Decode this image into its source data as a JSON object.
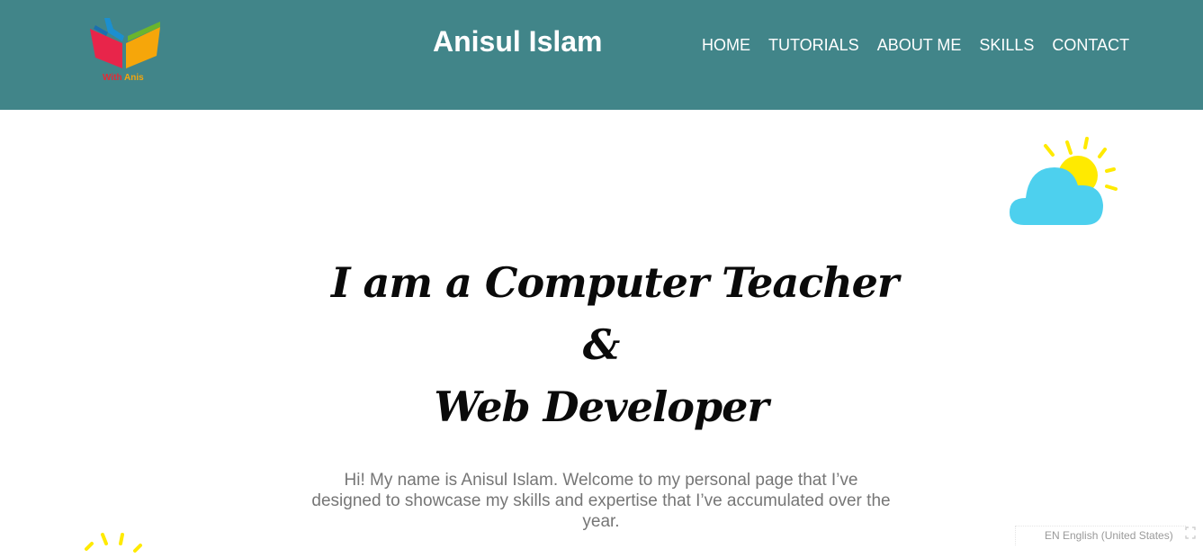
{
  "brand": {
    "logo_text_part1": "With ",
    "logo_text_part2": "Anis",
    "site_title": "Anisul Islam"
  },
  "nav": {
    "items": [
      "HOME",
      "TUTORIALS",
      "ABOUT ME",
      "SKILLS",
      "CONTACT"
    ]
  },
  "hero": {
    "line1": "I am a Computer Teacher",
    "line2": "&",
    "line3": "Web Developer"
  },
  "intro": {
    "text": "Hi! My name is Anisul Islam. Welcome to my personal page that I’ve designed to showcase my skills and expertise that I’ve accumulated over the year."
  },
  "language_bar": {
    "label": "EN English (United States)"
  },
  "colors": {
    "header_bg": "#418589",
    "nav_text": "#ffffff",
    "hero_text": "#0a0a0a",
    "intro_text": "#767676",
    "sun": "#ffea00",
    "cloud": "#4dd0ee"
  },
  "icons": [
    "book-logo-icon",
    "sun-cloud-icon",
    "sun-rays-icon",
    "expand-icon"
  ]
}
